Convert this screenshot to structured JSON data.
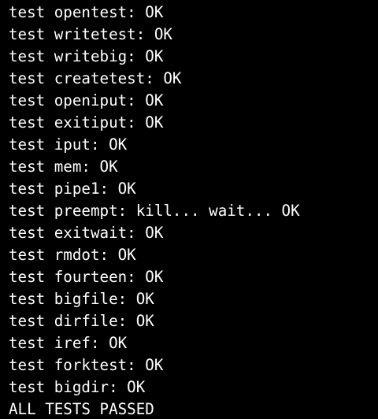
{
  "terminal": {
    "foreground": "#ffffff",
    "background": "#000000",
    "lines": [
      "test opentest: OK",
      "test writetest: OK",
      "test writebig: OK",
      "test createtest: OK",
      "test openiput: OK",
      "test exitiput: OK",
      "test iput: OK",
      "test mem: OK",
      "test pipe1: OK",
      "test preempt: kill... wait... OK",
      "test exitwait: OK",
      "test rmdot: OK",
      "test fourteen: OK",
      "test bigfile: OK",
      "test dirfile: OK",
      "test iref: OK",
      "test forktest: OK",
      "test bigdir: OK",
      "ALL TESTS PASSED"
    ]
  }
}
